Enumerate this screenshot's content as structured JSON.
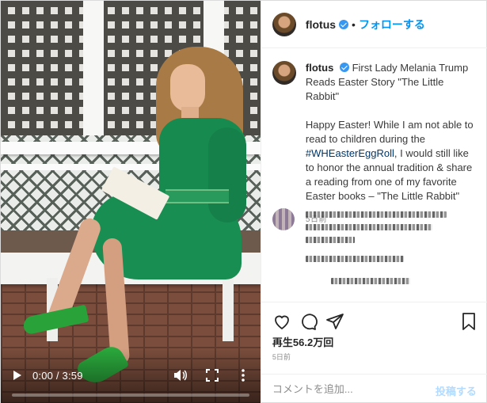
{
  "video": {
    "current_time": "0:00",
    "duration": "3:59",
    "time_display": "0:00 / 3:59",
    "progress_fraction": 0.0
  },
  "header": {
    "username": "flotus",
    "verified": true,
    "separator": "•",
    "follow_label": "フォローする"
  },
  "caption": {
    "username": "flotus",
    "title": "First Lady Melania Trump Reads Easter Story \"The Little Rabbit\"",
    "text_before_hashtag": "Happy Easter! While I am not able to read to children during the ",
    "hashtag": "#WHEasterEggRoll",
    "text_after_hashtag": ", I would still like to honor the annual tradition & share a reading from one of my favorite Easter books – \"The Little Rabbit\"",
    "age": "5日前"
  },
  "actions": {
    "icons": [
      "heart-icon",
      "comment-icon",
      "share-icon",
      "bookmark-icon"
    ],
    "views": "再生56.2万回",
    "age": "5日前"
  },
  "comment_box": {
    "placeholder": "コメントを追加...",
    "post_label": "投稿する"
  },
  "colors": {
    "accent": "#0095f6",
    "verified": "#3897f0",
    "hashtag": "#00376b",
    "post_disabled": "#b3dbff"
  }
}
